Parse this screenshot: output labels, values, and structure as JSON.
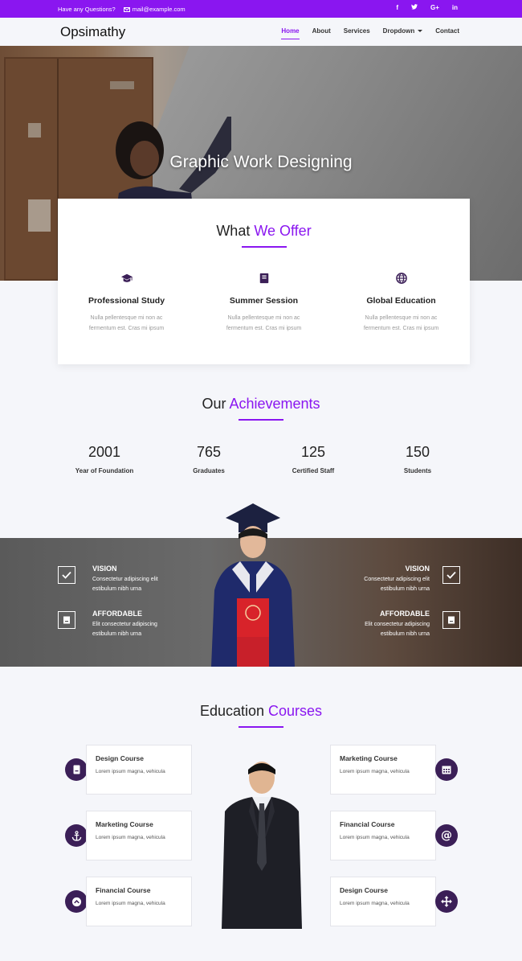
{
  "topbar": {
    "question": "Have any Questions?",
    "email": "mail@example.com",
    "socials": [
      "facebook-icon",
      "twitter-icon",
      "google-plus-icon",
      "linkedin-icon"
    ],
    "social_glyphs": [
      "f",
      "ᴛ",
      "G+",
      "in"
    ]
  },
  "nav": {
    "brand": "Opsimathy",
    "items": [
      "Home",
      "About",
      "Services",
      "Dropdown",
      "Contact"
    ],
    "active": "Home"
  },
  "hero": {
    "title": "Graphic Work Designing"
  },
  "offer": {
    "title_plain": "What ",
    "title_accent": "We Offer",
    "features": [
      {
        "icon": "graduation-cap-icon",
        "title": "Professional Study",
        "desc": "Nulla pellentesque mi non ac fermentum est. Cras mi ipsum"
      },
      {
        "icon": "book-icon",
        "title": "Summer Session",
        "desc": "Nulla pellentesque mi non ac fermentum est. Cras mi ipsum"
      },
      {
        "icon": "globe-icon",
        "title": "Global Education",
        "desc": "Nulla pellentesque mi non ac fermentum est. Cras mi ipsum"
      }
    ]
  },
  "achievements": {
    "title_plain": "Our ",
    "title_accent": "Achievements",
    "stats": [
      {
        "num": "2001",
        "label": "Year of Foundation"
      },
      {
        "num": "765",
        "label": "Graduates"
      },
      {
        "num": "125",
        "label": "Certified Staff"
      },
      {
        "num": "150",
        "label": "Students"
      }
    ]
  },
  "banner": {
    "left": [
      {
        "icon": "check-square-icon",
        "title": "VISION",
        "desc1": "Consectetur adipiscing elit",
        "desc2": "estibulum nibh urna"
      },
      {
        "icon": "book-square-icon",
        "title": "AFFORDABLE",
        "desc1": "Elit consectetur adipiscing",
        "desc2": "estibulum nibh urna"
      }
    ],
    "right": [
      {
        "icon": "check-square-icon",
        "title": "VISION",
        "desc1": "Consectetur adipiscing elit",
        "desc2": "estibulum nibh urna"
      },
      {
        "icon": "book-square-icon",
        "title": "AFFORDABLE",
        "desc1": "Elit consectetur adipiscing",
        "desc2": "estibulum nibh urna"
      }
    ]
  },
  "courses": {
    "title_plain": "Education ",
    "title_accent": "Courses",
    "left": [
      {
        "icon": "book-icon",
        "title": "Design Course",
        "desc": "Lorem ipsum magna, vehicula"
      },
      {
        "icon": "anchor-icon",
        "title": "Marketing Course",
        "desc": "Lorem ipsum magna, vehicula"
      },
      {
        "icon": "chevron-up-circle-icon",
        "title": "Financial Course",
        "desc": "Lorem ipsum magna, vehicula"
      }
    ],
    "right": [
      {
        "icon": "calendar-icon",
        "title": "Marketing Course",
        "desc": "Lorem ipsum magna, vehicula"
      },
      {
        "icon": "at-icon",
        "title": "Financial Course",
        "desc": "Lorem ipsum magna, vehicula"
      },
      {
        "icon": "move-icon",
        "title": "Design Course",
        "desc": "Lorem ipsum magna, vehicula"
      }
    ]
  },
  "colors": {
    "accent": "#8a16f0",
    "dark_icon_bg": "#3b1f57"
  }
}
